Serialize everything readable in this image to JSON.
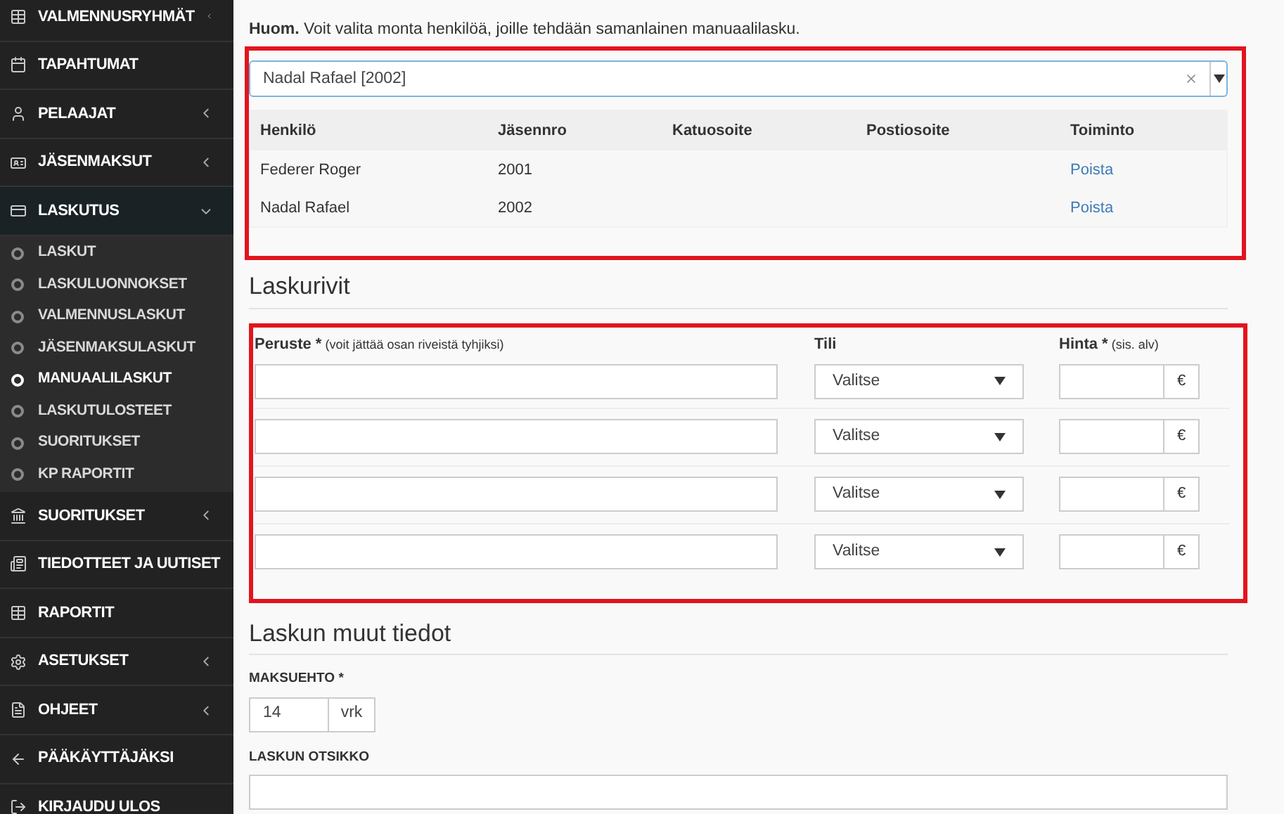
{
  "sidebar": {
    "items": [
      {
        "label": "VALMENNUSRYHMÄT",
        "kind": "group",
        "expanded": false
      },
      {
        "label": "TAPAHTUMAT",
        "kind": "link"
      },
      {
        "label": "PELAAJAT",
        "kind": "group",
        "expanded": false
      },
      {
        "label": "JÄSENMAKSUT",
        "kind": "group",
        "expanded": false
      },
      {
        "label": "LASKUTUS",
        "kind": "group",
        "expanded": true,
        "children": [
          {
            "label": "LASKUT",
            "selected": false
          },
          {
            "label": "LASKULUONNOKSET",
            "selected": false
          },
          {
            "label": "VALMENNUSLASKUT",
            "selected": false
          },
          {
            "label": "JÄSENMAKSULASKUT",
            "selected": false
          },
          {
            "label": "MANUAALILASKUT",
            "selected": true
          },
          {
            "label": "LASKUTULOSTEET",
            "selected": false
          },
          {
            "label": "SUORITUKSET",
            "selected": false
          },
          {
            "label": "KP RAPORTIT",
            "selected": false
          }
        ]
      },
      {
        "label": "SUORITUKSET",
        "kind": "group",
        "expanded": false
      },
      {
        "label": "TIEDOTTEET JA UUTISET",
        "kind": "link"
      },
      {
        "label": "RAPORTIT",
        "kind": "link"
      },
      {
        "label": "ASETUKSET",
        "kind": "group",
        "expanded": false
      },
      {
        "label": "OHJEET",
        "kind": "group",
        "expanded": false
      },
      {
        "label": "PÄÄKÄYTTÄJÄKSI",
        "kind": "link"
      },
      {
        "label": "KIRJAUDU ULOS",
        "kind": "link"
      }
    ]
  },
  "note": "**Huom.** Voit valita monta henkilöä, joille tehdään samanlainen manuaalilasku.",
  "person_select": {
    "value": "Nadal Rafael [2002]"
  },
  "persons_table": {
    "columns": [
      "Henkilö",
      "Jäsennro",
      "Katuosoite",
      "Postiosoite",
      "Toiminto"
    ],
    "rows": [
      {
        "cells": [
          "Federer Roger",
          "2001",
          "",
          ""
        ],
        "action": "Poista"
      },
      {
        "cells": [
          "Nadal Rafael",
          "2002",
          "",
          ""
        ],
        "action": "Poista"
      }
    ]
  },
  "invoice_rows": {
    "heading": "Laskurivit",
    "columns": [
      {
        "label": "Peruste *",
        "hint": "(voit jättää osan riveistä tyhjiksi)"
      },
      {
        "label": "Tili"
      },
      {
        "label": "Hinta *",
        "hint": "(sis. alv)"
      }
    ],
    "rows": [
      {
        "account": "Valitse",
        "currency": "€"
      },
      {
        "account": "Valitse",
        "currency": "€"
      },
      {
        "account": "Valitse",
        "currency": "€"
      },
      {
        "account": "Valitse",
        "currency": "€"
      }
    ]
  },
  "other_info": {
    "heading": "Laskun muut tiedot",
    "payment_term": {
      "label": "MAKSUEHTO *",
      "value": "14",
      "unit": "vrk"
    },
    "invoice_title": {
      "label": "LASKUN OTSIKKO"
    }
  }
}
